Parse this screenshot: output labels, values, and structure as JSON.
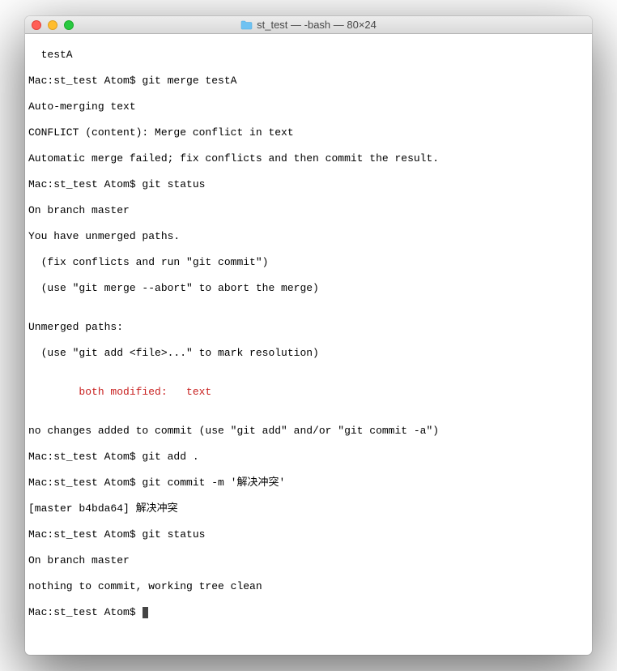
{
  "window": {
    "title": "st_test — -bash — 80×24"
  },
  "lines": {
    "l0": "  testA",
    "l1": "Mac:st_test Atom$ git merge testA",
    "l2": "Auto-merging text",
    "l3": "CONFLICT (content): Merge conflict in text",
    "l4": "Automatic merge failed; fix conflicts and then commit the result.",
    "l5": "Mac:st_test Atom$ git status",
    "l6": "On branch master",
    "l7": "You have unmerged paths.",
    "l8": "  (fix conflicts and run \"git commit\")",
    "l9": "  (use \"git merge --abort\" to abort the merge)",
    "l10": "",
    "l11": "Unmerged paths:",
    "l12": "  (use \"git add <file>...\" to mark resolution)",
    "l13": "",
    "l14": "        both modified:   text",
    "l15": "",
    "l16": "no changes added to commit (use \"git add\" and/or \"git commit -a\")",
    "l17": "Mac:st_test Atom$ git add .",
    "l18": "Mac:st_test Atom$ git commit -m '解决冲突'",
    "l19": "[master b4bda64] 解决冲突",
    "l20": "Mac:st_test Atom$ git status",
    "l21": "On branch master",
    "l22": "nothing to commit, working tree clean",
    "l23": "Mac:st_test Atom$ "
  }
}
